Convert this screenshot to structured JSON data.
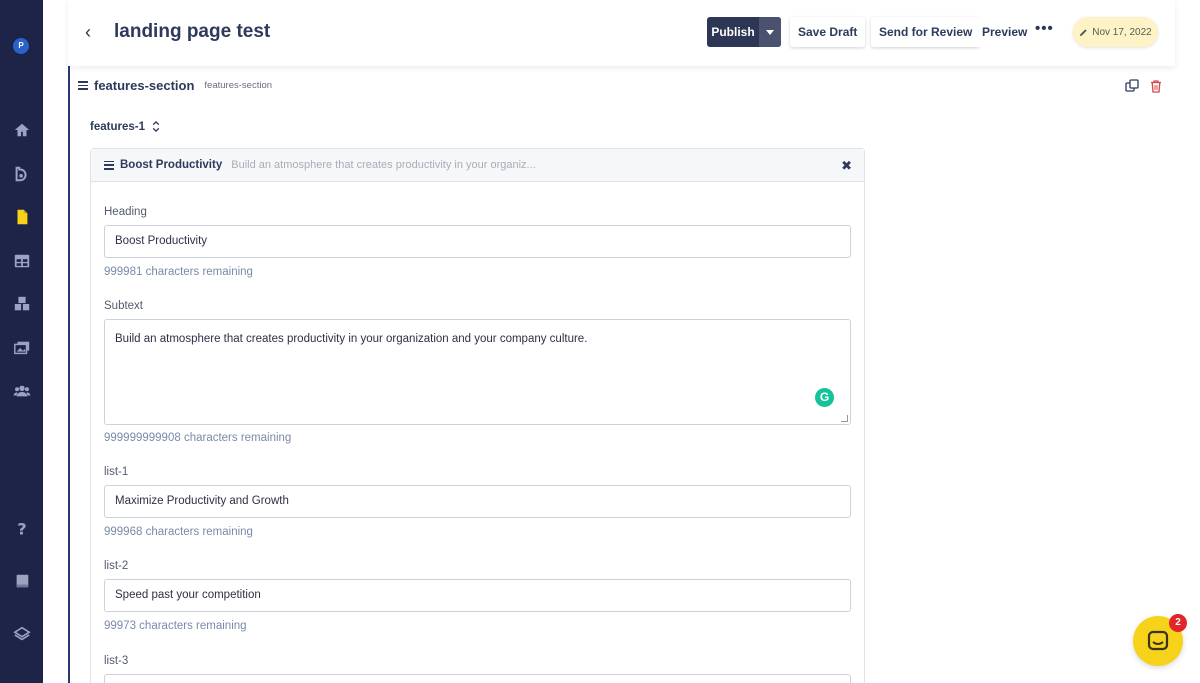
{
  "rail": {
    "logo_letter": "P",
    "icons": [
      "home-icon",
      "blog-icon",
      "page-icon",
      "table-icon",
      "components-icon",
      "media-icon",
      "users-icon",
      "help-icon",
      "book-icon",
      "layers-icon"
    ]
  },
  "header": {
    "back_glyph": "‹",
    "title": "landing page test",
    "publish_label": "Publish",
    "save_draft_label": "Save Draft",
    "send_review_label": "Send for Review",
    "preview_label": "Preview",
    "more_glyph": "•••",
    "date": "Nov 17, 2022"
  },
  "section": {
    "title": "features-section",
    "subtitle": "features-section",
    "selector_label": "features-1"
  },
  "card": {
    "title": "Boost Productivity",
    "summary": "Build an atmosphere that creates productivity in your organiz...",
    "close_glyph": "✖",
    "fields": [
      {
        "label": "Heading",
        "value": "Boost Productivity",
        "remaining": "999981 characters remaining"
      },
      {
        "label": "Subtext",
        "value": "Build an atmosphere that creates productivity in your organization and your company culture.",
        "remaining": "999999999908 characters remaining"
      },
      {
        "label": "list-1",
        "value": "Maximize Productivity and Growth",
        "remaining": "999968 characters remaining"
      },
      {
        "label": "list-2",
        "value": "Speed past your competition",
        "remaining": "99973 characters remaining"
      },
      {
        "label": "list-3",
        "value": ""
      }
    ],
    "grammarly_letter": "G"
  },
  "chat": {
    "badge_count": "2"
  },
  "colors": {
    "rail": "#1d2447",
    "publish": "#2d3654",
    "accent_border": "#2a3875",
    "date_pill": "#fdf3c7",
    "chat": "#f6d21b",
    "badge": "#e0262b"
  }
}
